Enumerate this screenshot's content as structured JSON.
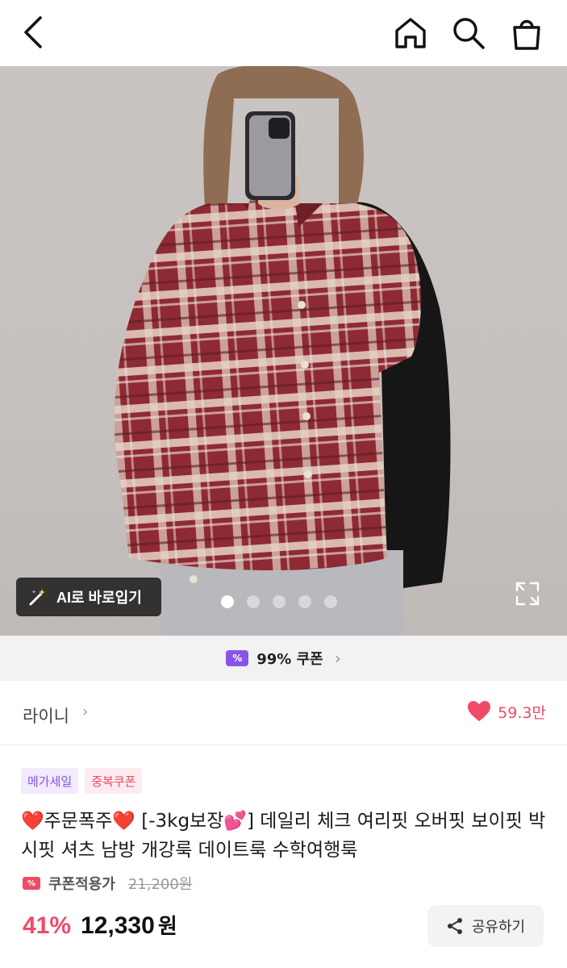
{
  "header": {
    "icons": [
      "back-icon",
      "home-icon",
      "search-icon",
      "shopping-bag-icon"
    ]
  },
  "hero": {
    "ai_button_label": "AI로 바로입기",
    "carousel_total": 5,
    "carousel_active": 1
  },
  "coupon_strip": {
    "icon_text": "%",
    "label": "99% 쿠폰",
    "chevron": "›"
  },
  "store": {
    "name": "라이니",
    "chevron": "›",
    "likes": "59.3만"
  },
  "badges": {
    "mega": "메가세일",
    "dup": "중복쿠폰"
  },
  "product": {
    "title": "❤️주문폭주❤️ [-3kg보장💕] 데일리 체크 여리핏 오버핏 보이핏 박시핏 셔츠 남방 개강룩 데이트룩 수학여행룩"
  },
  "pricing": {
    "coupon_label": "쿠폰적용가",
    "original_price": "21,200원",
    "discount": "41%",
    "price": "12,330",
    "currency": "원"
  },
  "share": {
    "label": "공유하기"
  },
  "colors": {
    "accent_pink": "#f04a67",
    "accent_purple": "#8a54e8"
  }
}
